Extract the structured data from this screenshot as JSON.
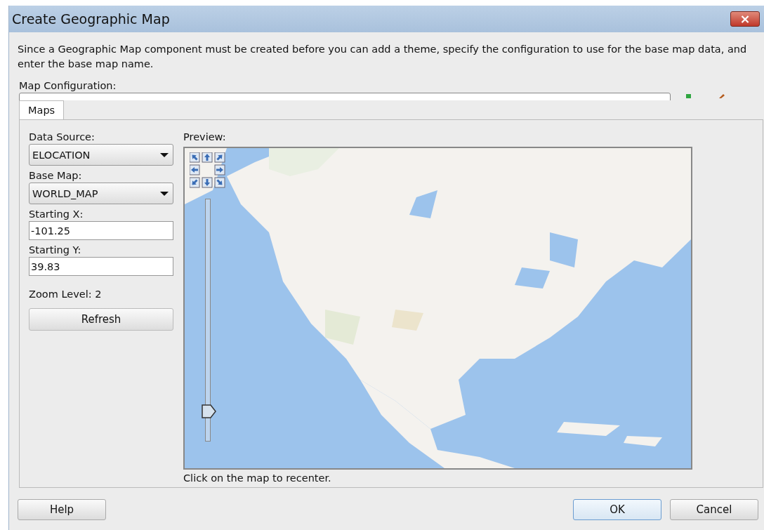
{
  "window": {
    "title": "Create Geographic Map",
    "close": "×"
  },
  "description": "Since a Geographic Map component must be created before you can add a theme, specify the configuration to use for the base map data, and enter the base map name.",
  "map_configuration": {
    "label": "Map Configuration:"
  },
  "tabs": [
    {
      "label": "Maps",
      "selected": true
    }
  ],
  "data_source": {
    "label": "Data Source:",
    "value": "ELOCATION"
  },
  "base_map": {
    "label": "Base Map:",
    "value": "WORLD_MAP"
  },
  "starting_x": {
    "label": "Starting X:",
    "value": "-101.25"
  },
  "starting_y": {
    "label": "Starting Y:",
    "value": "39.83"
  },
  "zoom_level": "Zoom Level: 2",
  "refresh_button": "Refresh",
  "preview": {
    "label": "Preview:",
    "zoom_slider": {
      "level": 0.1
    },
    "hint": "Click on the map to recenter."
  },
  "buttons": [
    {
      "label": "Help",
      "kind": "help"
    },
    {
      "label": "OK",
      "kind": "default"
    },
    {
      "label": "Cancel",
      "kind": "normal"
    }
  ]
}
